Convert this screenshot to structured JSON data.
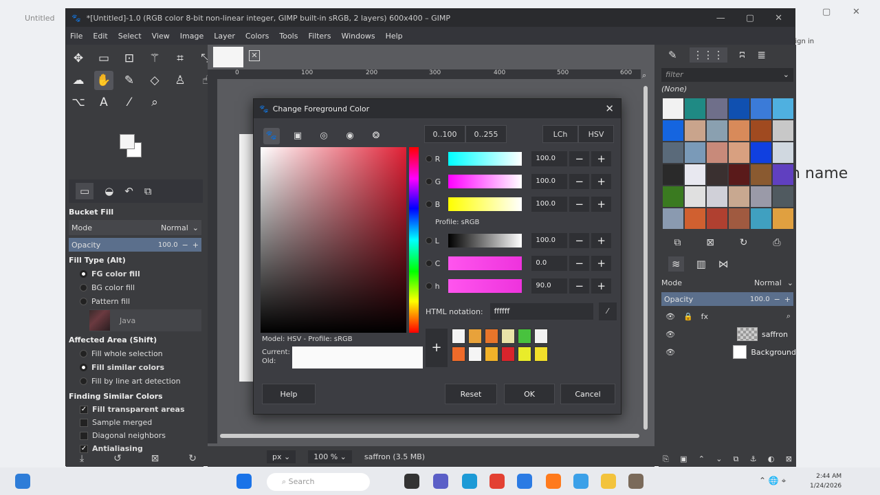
{
  "window": {
    "title": "*[Untitled]-1.0 (RGB color 8-bit non-linear integer, GIMP built-in sRGB, 2 layers) 600x400 – GIMP"
  },
  "browser": {
    "tab_label": "Untitled",
    "sign_in": "Sign in",
    "side_text": "h name"
  },
  "menu": [
    "File",
    "Edit",
    "Select",
    "View",
    "Image",
    "Layer",
    "Colors",
    "Tools",
    "Filters",
    "Windows",
    "Help"
  ],
  "tool_options": {
    "title": "Bucket Fill",
    "mode_label": "Mode",
    "mode_value": "Normal",
    "opacity_label": "Opacity",
    "opacity_value": "100.0",
    "fill_type_title": "Fill Type  (Alt)",
    "fill_types": [
      "FG color fill",
      "BG color fill",
      "Pattern fill"
    ],
    "pattern_name": "Java",
    "affected_title": "Affected Area  (Shift)",
    "affected": [
      "Fill whole selection",
      "Fill similar colors",
      "Fill by line art detection"
    ],
    "finding_title": "Finding Similar Colors",
    "finding": [
      {
        "label": "Fill transparent areas",
        "checked": true
      },
      {
        "label": "Sample merged",
        "checked": false
      },
      {
        "label": "Diagonal neighbors",
        "checked": false
      },
      {
        "label": "Antialiasing",
        "checked": true
      }
    ]
  },
  "canvas": {
    "ruler_labels": [
      "0",
      "100",
      "200",
      "300",
      "400",
      "500",
      "600"
    ],
    "unit": "px",
    "zoom": "100 %",
    "status": "saffron (3.5 MB)"
  },
  "patterns": {
    "filter_placeholder": "filter",
    "selected": "(None)"
  },
  "layers": {
    "mode_label": "Mode",
    "mode_value": "Normal",
    "opacity_label": "Opacity",
    "opacity_value": "100.0",
    "items": [
      "saffron",
      "Background"
    ]
  },
  "dialog": {
    "title": "Change Foreground Color",
    "range_buttons": [
      "0..100",
      "0..255"
    ],
    "model_buttons": [
      "LCh",
      "HSV"
    ],
    "channels_rgb": [
      {
        "letter": "R",
        "value": "100.0"
      },
      {
        "letter": "G",
        "value": "100.0"
      },
      {
        "letter": "B",
        "value": "100.0"
      }
    ],
    "profile": "Profile: sRGB",
    "channels_lch": [
      {
        "letter": "L",
        "value": "100.0"
      },
      {
        "letter": "C",
        "value": "0.0"
      },
      {
        "letter": "h",
        "value": "90.0"
      }
    ],
    "html_label": "HTML notation:",
    "html_value": "ffffff",
    "model_label": "Model: HSV - Profile: sRGB",
    "current_label": "Current:",
    "old_label": "Old:",
    "help": "Help",
    "reset": "Reset",
    "ok": "OK",
    "cancel": "Cancel",
    "history_colors": [
      "#f4f4f4",
      "#e8a23a",
      "#e8752a",
      "#e9e3a8",
      "#48c23e",
      "#f2f2f2",
      "#ef6b2a",
      "#f5f5f5",
      "#f2b229",
      "#d8242c",
      "#e9ec2a",
      "#f2df2a"
    ]
  },
  "taskbar": {
    "search": "Search",
    "time": "2:44 AM",
    "date": "1/24/2026"
  }
}
